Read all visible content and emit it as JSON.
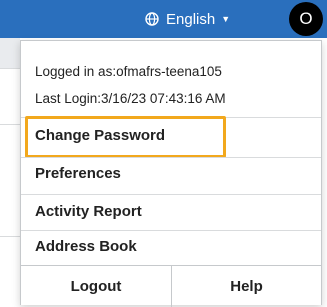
{
  "header": {
    "language_label": "English",
    "avatar_initial": "O"
  },
  "menu": {
    "logged_in_text": "Logged in as:ofmafrs-teena105",
    "last_login_text": "Last Login:3/16/23 07:43:16 AM",
    "items": [
      {
        "label": "Change Password",
        "highlighted": true
      },
      {
        "label": "Preferences"
      },
      {
        "label": "Activity Report"
      },
      {
        "label": "Address Book"
      }
    ],
    "footer": {
      "logout_label": "Logout",
      "help_label": "Help"
    }
  },
  "colors": {
    "header_background": "#2a6fbd",
    "highlight_border": "#f2a81d"
  }
}
